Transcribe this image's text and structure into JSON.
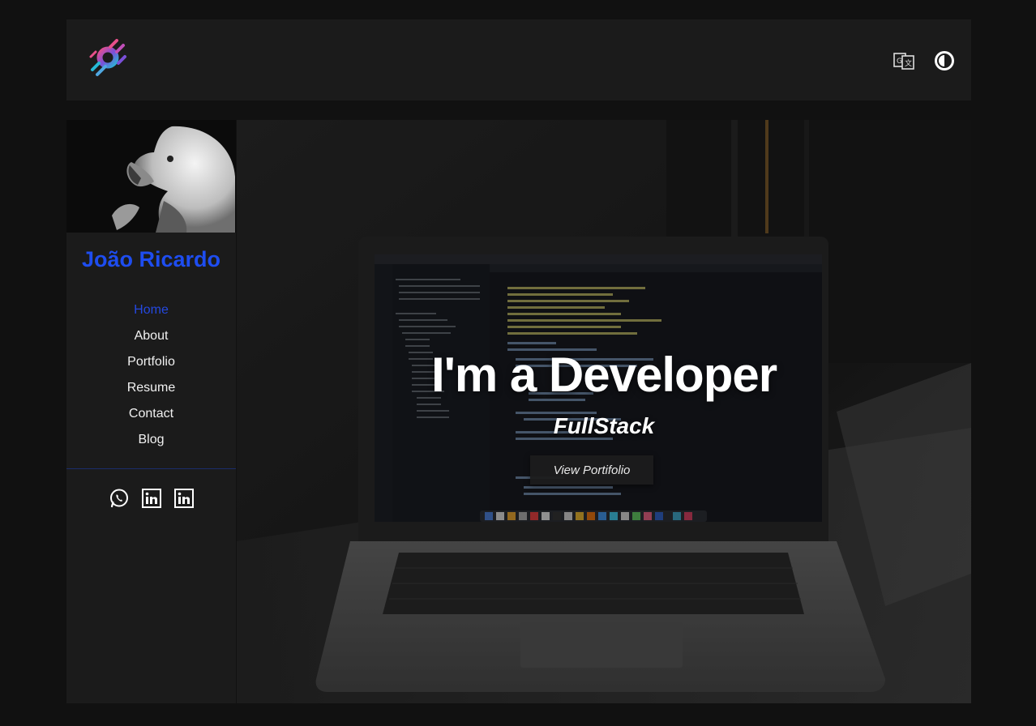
{
  "header": {
    "logo_icon": "brand-logo-icon",
    "translate_icon": "translate-icon",
    "theme_icon": "contrast-icon"
  },
  "profile": {
    "name": "João Ricardo",
    "avatar_icon": "eagle-avatar"
  },
  "nav": {
    "items": [
      {
        "label": "Home",
        "active": true
      },
      {
        "label": "About"
      },
      {
        "label": "Portfolio"
      },
      {
        "label": "Resume"
      },
      {
        "label": "Contact"
      },
      {
        "label": "Blog"
      }
    ]
  },
  "social": [
    "whatsapp-icon",
    "linkedin-icon",
    "linkedin-icon"
  ],
  "hero": {
    "title": "I'm a Developer",
    "subtitle": "FullStack",
    "button_label": "View Portifolio"
  },
  "colors": {
    "accent": "#1e4df0",
    "background": "#111111",
    "panel": "#1b1b1b"
  }
}
